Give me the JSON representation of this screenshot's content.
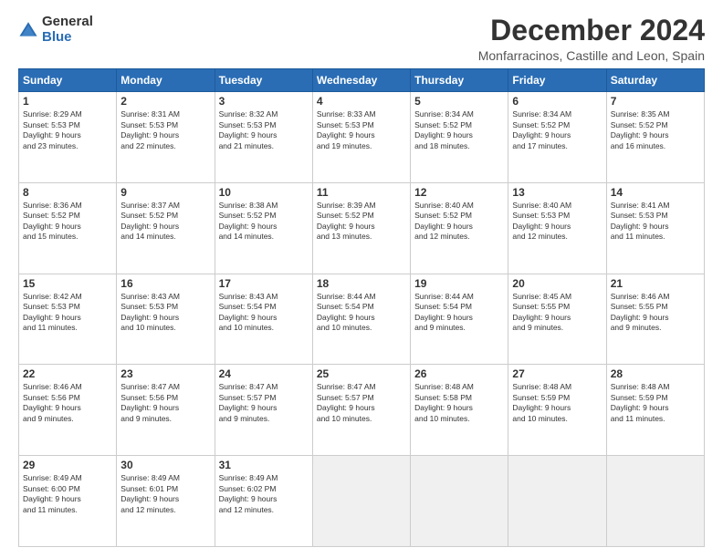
{
  "logo": {
    "general": "General",
    "blue": "Blue"
  },
  "header": {
    "month": "December 2024",
    "location": "Monfarracinos, Castille and Leon, Spain"
  },
  "weekdays": [
    "Sunday",
    "Monday",
    "Tuesday",
    "Wednesday",
    "Thursday",
    "Friday",
    "Saturday"
  ],
  "weeks": [
    [
      {
        "day": "1",
        "info": "Sunrise: 8:29 AM\nSunset: 5:53 PM\nDaylight: 9 hours\nand 23 minutes."
      },
      {
        "day": "2",
        "info": "Sunrise: 8:31 AM\nSunset: 5:53 PM\nDaylight: 9 hours\nand 22 minutes."
      },
      {
        "day": "3",
        "info": "Sunrise: 8:32 AM\nSunset: 5:53 PM\nDaylight: 9 hours\nand 21 minutes."
      },
      {
        "day": "4",
        "info": "Sunrise: 8:33 AM\nSunset: 5:53 PM\nDaylight: 9 hours\nand 19 minutes."
      },
      {
        "day": "5",
        "info": "Sunrise: 8:34 AM\nSunset: 5:52 PM\nDaylight: 9 hours\nand 18 minutes."
      },
      {
        "day": "6",
        "info": "Sunrise: 8:34 AM\nSunset: 5:52 PM\nDaylight: 9 hours\nand 17 minutes."
      },
      {
        "day": "7",
        "info": "Sunrise: 8:35 AM\nSunset: 5:52 PM\nDaylight: 9 hours\nand 16 minutes."
      }
    ],
    [
      {
        "day": "8",
        "info": "Sunrise: 8:36 AM\nSunset: 5:52 PM\nDaylight: 9 hours\nand 15 minutes."
      },
      {
        "day": "9",
        "info": "Sunrise: 8:37 AM\nSunset: 5:52 PM\nDaylight: 9 hours\nand 14 minutes."
      },
      {
        "day": "10",
        "info": "Sunrise: 8:38 AM\nSunset: 5:52 PM\nDaylight: 9 hours\nand 14 minutes."
      },
      {
        "day": "11",
        "info": "Sunrise: 8:39 AM\nSunset: 5:52 PM\nDaylight: 9 hours\nand 13 minutes."
      },
      {
        "day": "12",
        "info": "Sunrise: 8:40 AM\nSunset: 5:52 PM\nDaylight: 9 hours\nand 12 minutes."
      },
      {
        "day": "13",
        "info": "Sunrise: 8:40 AM\nSunset: 5:53 PM\nDaylight: 9 hours\nand 12 minutes."
      },
      {
        "day": "14",
        "info": "Sunrise: 8:41 AM\nSunset: 5:53 PM\nDaylight: 9 hours\nand 11 minutes."
      }
    ],
    [
      {
        "day": "15",
        "info": "Sunrise: 8:42 AM\nSunset: 5:53 PM\nDaylight: 9 hours\nand 11 minutes."
      },
      {
        "day": "16",
        "info": "Sunrise: 8:43 AM\nSunset: 5:53 PM\nDaylight: 9 hours\nand 10 minutes."
      },
      {
        "day": "17",
        "info": "Sunrise: 8:43 AM\nSunset: 5:54 PM\nDaylight: 9 hours\nand 10 minutes."
      },
      {
        "day": "18",
        "info": "Sunrise: 8:44 AM\nSunset: 5:54 PM\nDaylight: 9 hours\nand 10 minutes."
      },
      {
        "day": "19",
        "info": "Sunrise: 8:44 AM\nSunset: 5:54 PM\nDaylight: 9 hours\nand 9 minutes."
      },
      {
        "day": "20",
        "info": "Sunrise: 8:45 AM\nSunset: 5:55 PM\nDaylight: 9 hours\nand 9 minutes."
      },
      {
        "day": "21",
        "info": "Sunrise: 8:46 AM\nSunset: 5:55 PM\nDaylight: 9 hours\nand 9 minutes."
      }
    ],
    [
      {
        "day": "22",
        "info": "Sunrise: 8:46 AM\nSunset: 5:56 PM\nDaylight: 9 hours\nand 9 minutes."
      },
      {
        "day": "23",
        "info": "Sunrise: 8:47 AM\nSunset: 5:56 PM\nDaylight: 9 hours\nand 9 minutes."
      },
      {
        "day": "24",
        "info": "Sunrise: 8:47 AM\nSunset: 5:57 PM\nDaylight: 9 hours\nand 9 minutes."
      },
      {
        "day": "25",
        "info": "Sunrise: 8:47 AM\nSunset: 5:57 PM\nDaylight: 9 hours\nand 10 minutes."
      },
      {
        "day": "26",
        "info": "Sunrise: 8:48 AM\nSunset: 5:58 PM\nDaylight: 9 hours\nand 10 minutes."
      },
      {
        "day": "27",
        "info": "Sunrise: 8:48 AM\nSunset: 5:59 PM\nDaylight: 9 hours\nand 10 minutes."
      },
      {
        "day": "28",
        "info": "Sunrise: 8:48 AM\nSunset: 5:59 PM\nDaylight: 9 hours\nand 11 minutes."
      }
    ],
    [
      {
        "day": "29",
        "info": "Sunrise: 8:49 AM\nSunset: 6:00 PM\nDaylight: 9 hours\nand 11 minutes."
      },
      {
        "day": "30",
        "info": "Sunrise: 8:49 AM\nSunset: 6:01 PM\nDaylight: 9 hours\nand 12 minutes."
      },
      {
        "day": "31",
        "info": "Sunrise: 8:49 AM\nSunset: 6:02 PM\nDaylight: 9 hours\nand 12 minutes."
      },
      null,
      null,
      null,
      null
    ]
  ]
}
